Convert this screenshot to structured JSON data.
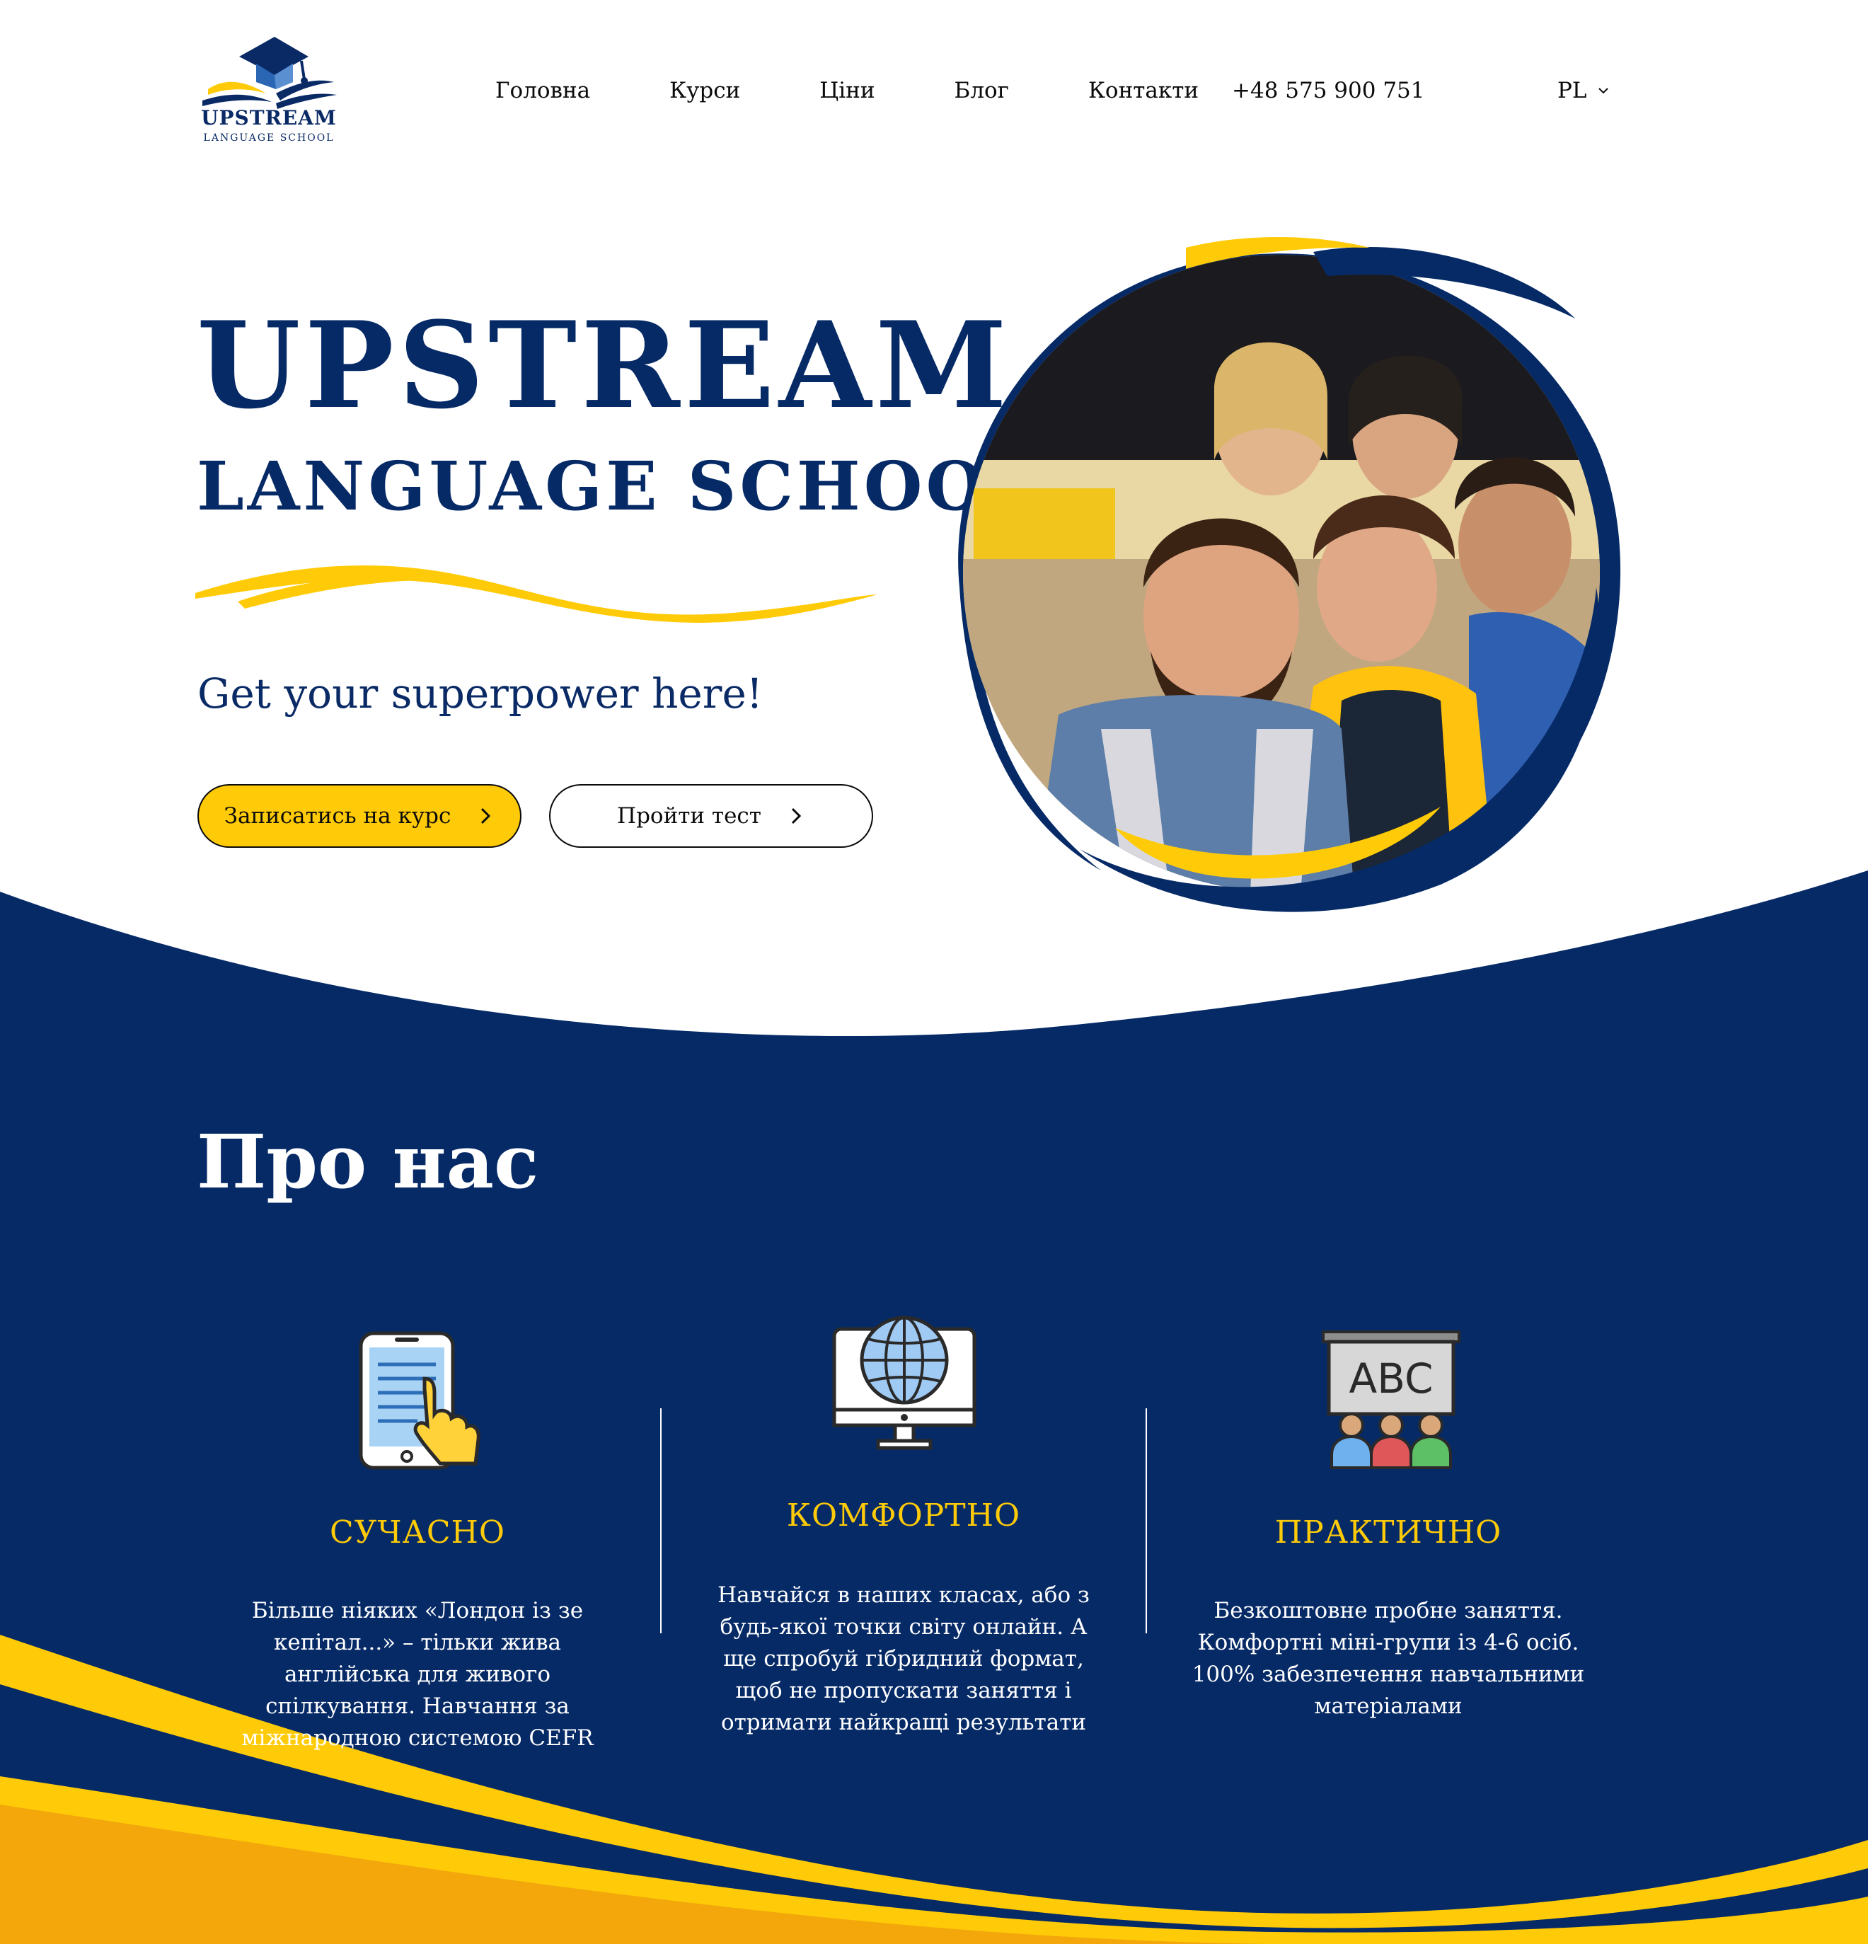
{
  "colors": {
    "navy": "#062a66",
    "yellow": "#ffcb08",
    "white": "#ffffff",
    "text": "#0b0b0b"
  },
  "logo": {
    "icon": "graduation-cap-books-icon",
    "name": "UPSTREAM",
    "subtitle": "LANGUAGE SCHOOL"
  },
  "nav": {
    "items": [
      "Головна",
      "Курси",
      "Ціни",
      "Блог",
      "Контакти"
    ],
    "phone": "+48 575 900 751",
    "language": "PL",
    "language_icon": "chevron-down-icon"
  },
  "hero": {
    "title": "UPSTREAM",
    "subtitle": "LANGUAGE SCHOOL",
    "tagline": "Get your superpower here!",
    "primary_button": "Записатись на курс",
    "secondary_button": "Пройти тест",
    "button_icon": "chevron-right-icon",
    "image": "group-of-smiling-students-photo"
  },
  "about": {
    "title": "Про нас",
    "features": [
      {
        "icon": "tablet-touch-icon",
        "title": "СУЧАСНО",
        "text": "Більше ніяких «Лондон із зе кепітал...» – тільки жива англійська для живого спілкування. Навчання за міжнародною системою CEFR"
      },
      {
        "icon": "computer-globe-icon",
        "title": "КОМФОРТНО",
        "text": "Навчайся в наших класах, або з будь-якої точки світу онлайн. А ще спробуй гібридний формат, щоб не пропускати заняття і отримати найкращі результати"
      },
      {
        "icon": "classroom-abc-icon",
        "title": "ПРАКТИЧНО",
        "text": "Безкоштовне пробне заняття. Комфортні міні-групи із 4-6 осіб. 100% забезпечення навчальними матеріалами"
      }
    ]
  }
}
